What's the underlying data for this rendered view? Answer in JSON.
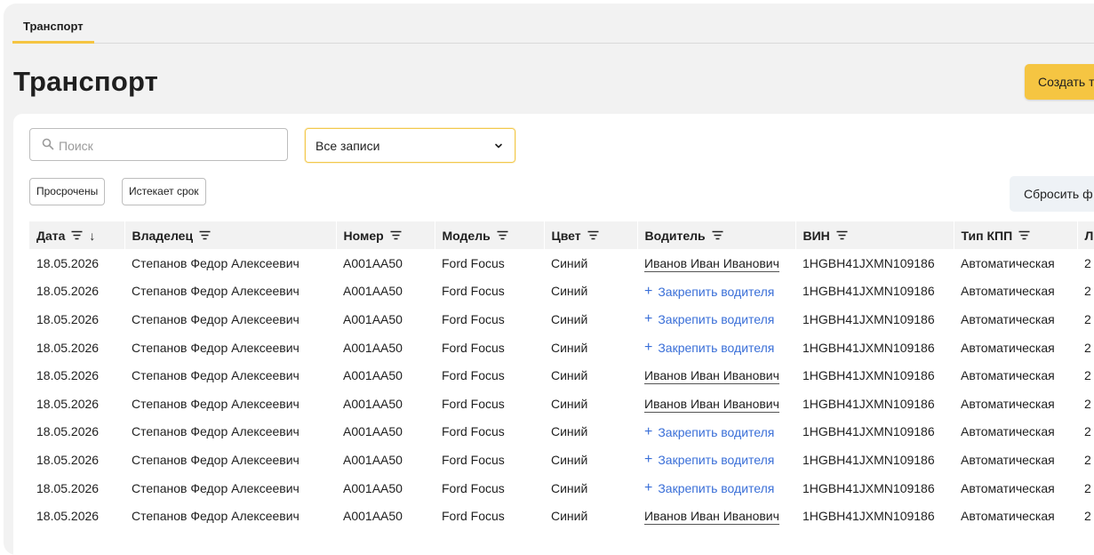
{
  "tabs": [
    {
      "label": "Транспорт"
    }
  ],
  "page": {
    "title": "Транспорт",
    "create_label": "Создать т"
  },
  "search": {
    "placeholder": "Поиск",
    "value": ""
  },
  "filter_select": {
    "selected": "Все записи"
  },
  "chips": {
    "overdue": "Просрочены",
    "expiring": "Истекает срок"
  },
  "reset_label": "Сбросить ф",
  "icons": {
    "search": "search-icon",
    "chevron": "chevron-down-icon",
    "filter": "filter-icon",
    "plus": "plus-icon"
  },
  "colors": {
    "accent": "#f5c542",
    "link": "#3a6fd8"
  },
  "table": {
    "columns": [
      {
        "label": "Дата",
        "sort": "↓"
      },
      {
        "label": "Владелец"
      },
      {
        "label": "Номер"
      },
      {
        "label": "Модель"
      },
      {
        "label": "Цвет"
      },
      {
        "label": "Водитель"
      },
      {
        "label": "ВИН"
      },
      {
        "label": "Тип КПП"
      },
      {
        "label": "Л"
      }
    ],
    "assign_label": "Закрепить водителя",
    "rows": [
      {
        "date": "18.05.2026",
        "owner": "Степанов Федор Алексеевич",
        "plate": "А001АА50",
        "model": "Ford Focus",
        "color": "Синий",
        "driver": "Иванов Иван Иванович",
        "vin": "1HGBH41JXMN109186",
        "gearbox": "Автоматическая",
        "extra": "2"
      },
      {
        "date": "18.05.2026",
        "owner": "Степанов Федор Алексеевич",
        "plate": "А001АА50",
        "model": "Ford Focus",
        "color": "Синий",
        "driver": null,
        "vin": "1HGBH41JXMN109186",
        "gearbox": "Автоматическая",
        "extra": "2"
      },
      {
        "date": "18.05.2026",
        "owner": "Степанов Федор Алексеевич",
        "plate": "А001АА50",
        "model": "Ford Focus",
        "color": "Синий",
        "driver": null,
        "vin": "1HGBH41JXMN109186",
        "gearbox": "Автоматическая",
        "extra": "2"
      },
      {
        "date": "18.05.2026",
        "owner": "Степанов Федор Алексеевич",
        "plate": "А001АА50",
        "model": "Ford Focus",
        "color": "Синий",
        "driver": null,
        "vin": "1HGBH41JXMN109186",
        "gearbox": "Автоматическая",
        "extra": "2"
      },
      {
        "date": "18.05.2026",
        "owner": "Степанов Федор Алексеевич",
        "plate": "А001АА50",
        "model": "Ford Focus",
        "color": "Синий",
        "driver": "Иванов Иван Иванович",
        "vin": "1HGBH41JXMN109186",
        "gearbox": "Автоматическая",
        "extra": "2"
      },
      {
        "date": "18.05.2026",
        "owner": "Степанов Федор Алексеевич",
        "plate": "А001АА50",
        "model": "Ford Focus",
        "color": "Синий",
        "driver": "Иванов Иван Иванович",
        "vin": "1HGBH41JXMN109186",
        "gearbox": "Автоматическая",
        "extra": "2"
      },
      {
        "date": "18.05.2026",
        "owner": "Степанов Федор Алексеевич",
        "plate": "А001АА50",
        "model": "Ford Focus",
        "color": "Синий",
        "driver": null,
        "vin": "1HGBH41JXMN109186",
        "gearbox": "Автоматическая",
        "extra": "2"
      },
      {
        "date": "18.05.2026",
        "owner": "Степанов Федор Алексеевич",
        "plate": "А001АА50",
        "model": "Ford Focus",
        "color": "Синий",
        "driver": null,
        "vin": "1HGBH41JXMN109186",
        "gearbox": "Автоматическая",
        "extra": "2"
      },
      {
        "date": "18.05.2026",
        "owner": "Степанов Федор Алексеевич",
        "plate": "А001АА50",
        "model": "Ford Focus",
        "color": "Синий",
        "driver": null,
        "vin": "1HGBH41JXMN109186",
        "gearbox": "Автоматическая",
        "extra": "2"
      },
      {
        "date": "18.05.2026",
        "owner": "Степанов Федор Алексеевич",
        "plate": "А001АА50",
        "model": "Ford Focus",
        "color": "Синий",
        "driver": "Иванов Иван Иванович",
        "vin": "1HGBH41JXMN109186",
        "gearbox": "Автоматическая",
        "extra": "2"
      }
    ]
  }
}
